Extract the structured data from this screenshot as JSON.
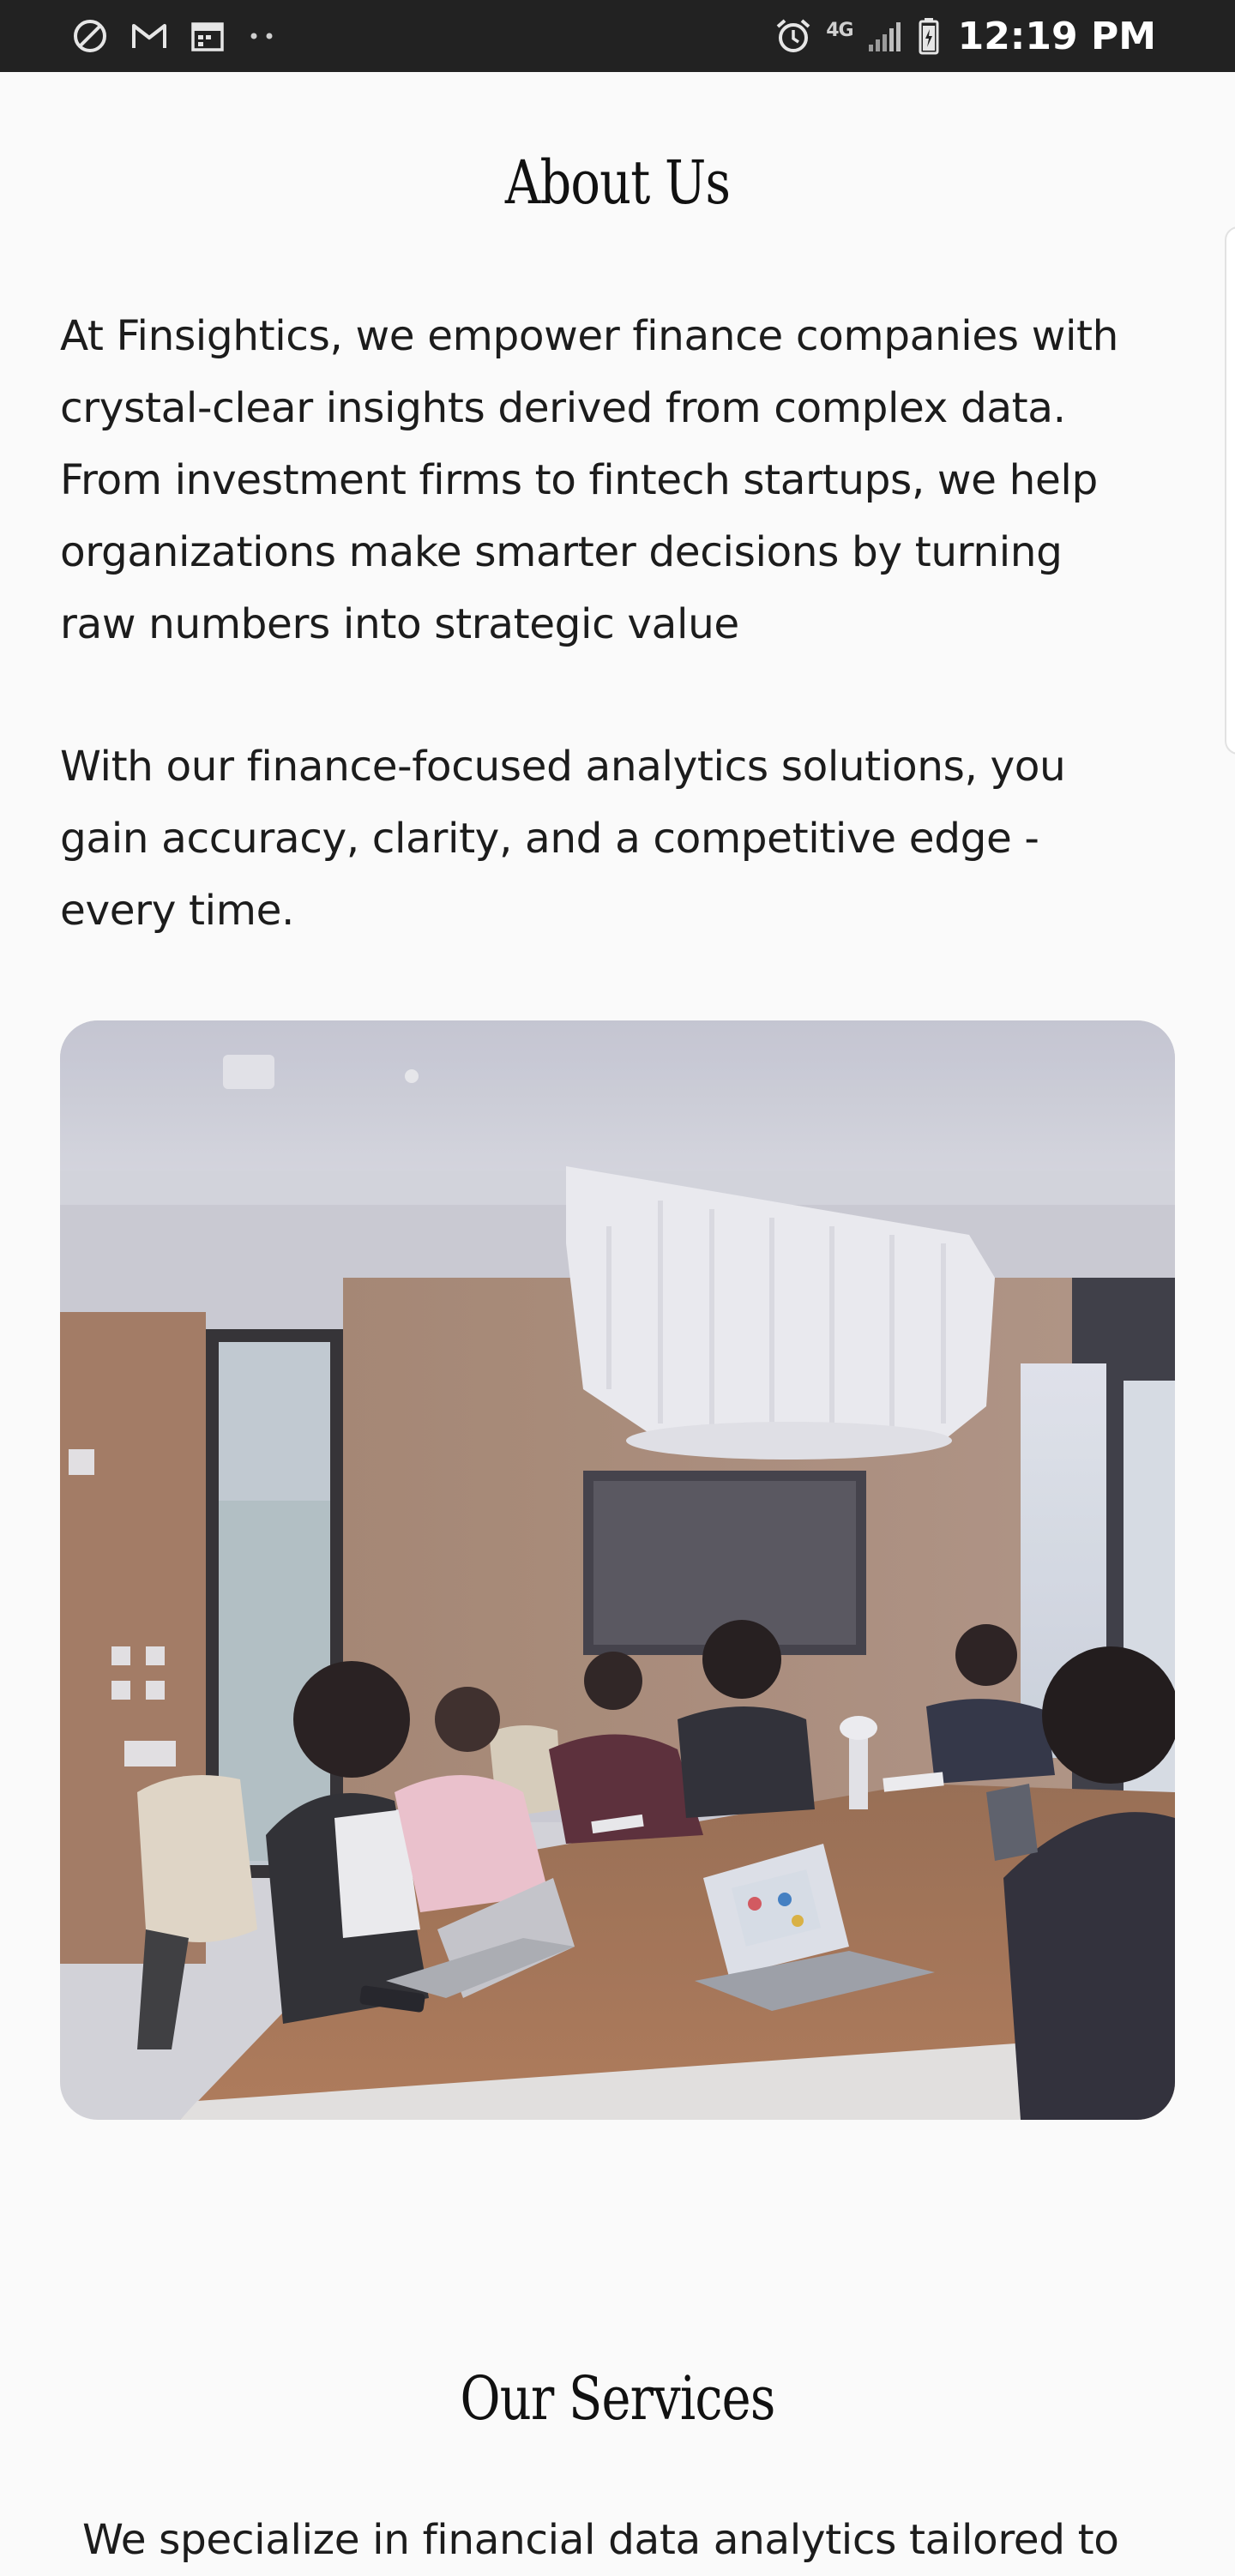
{
  "status_bar": {
    "time": "12:19 PM",
    "network": "4G",
    "icons": [
      "do-not-disturb-icon",
      "gmail-icon",
      "calendar-icon",
      "more-dots-icon",
      "alarm-icon",
      "network-4g-icon",
      "signal-icon",
      "battery-icon"
    ]
  },
  "about": {
    "title": "About Us",
    "paragraph1_lines": [
      "At Finsightics, we empower finance companies with",
      "crystal-clear insights derived from complex data.",
      "From investment firms to fintech startups, we help",
      "organizations make smarter decisions by turning",
      "raw numbers into strategic value"
    ],
    "paragraph2_lines": [
      "With our finance-focused analytics solutions, you",
      "gain accuracy, clarity, and a competitive edge -",
      "every time."
    ],
    "image_subject": "team-meeting-photo"
  },
  "services": {
    "title": "Our Services",
    "intro_visible": "We specialize in financial data analytics tailored to"
  },
  "colors": {
    "status_bar": "#222222",
    "background": "#fafafa",
    "text": "#1c1c1c"
  }
}
